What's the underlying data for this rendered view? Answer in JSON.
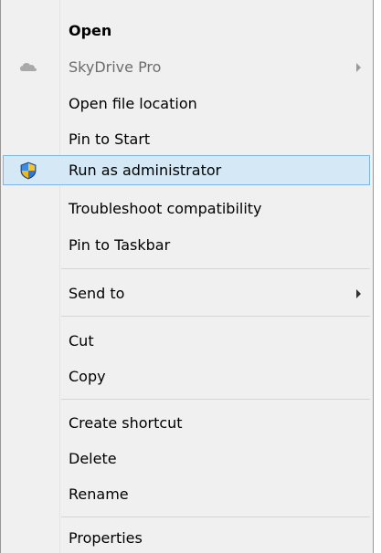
{
  "menu": {
    "open": "Open",
    "skydrive_pro": "SkyDrive Pro",
    "open_file_location": "Open file location",
    "pin_to_start": "Pin to Start",
    "run_as_administrator": "Run as administrator",
    "troubleshoot_compatibility": "Troubleshoot compatibility",
    "pin_to_taskbar": "Pin to Taskbar",
    "send_to": "Send to",
    "cut": "Cut",
    "copy": "Copy",
    "create_shortcut": "Create shortcut",
    "delete": "Delete",
    "rename": "Rename",
    "properties": "Properties"
  },
  "icons": {
    "skydrive": "cloud-icon",
    "run_as_admin": "uac-shield-icon",
    "submenu": "chevron-right-icon"
  },
  "colors": {
    "menu_background": "#f0f0f0",
    "hover_background": "#d5e8f6",
    "hover_border": "#7eb4ea",
    "disabled_text": "#6d6d6d"
  },
  "state": {
    "highlighted_item": "Run as administrator",
    "disabled_items": [
      "SkyDrive Pro"
    ]
  }
}
